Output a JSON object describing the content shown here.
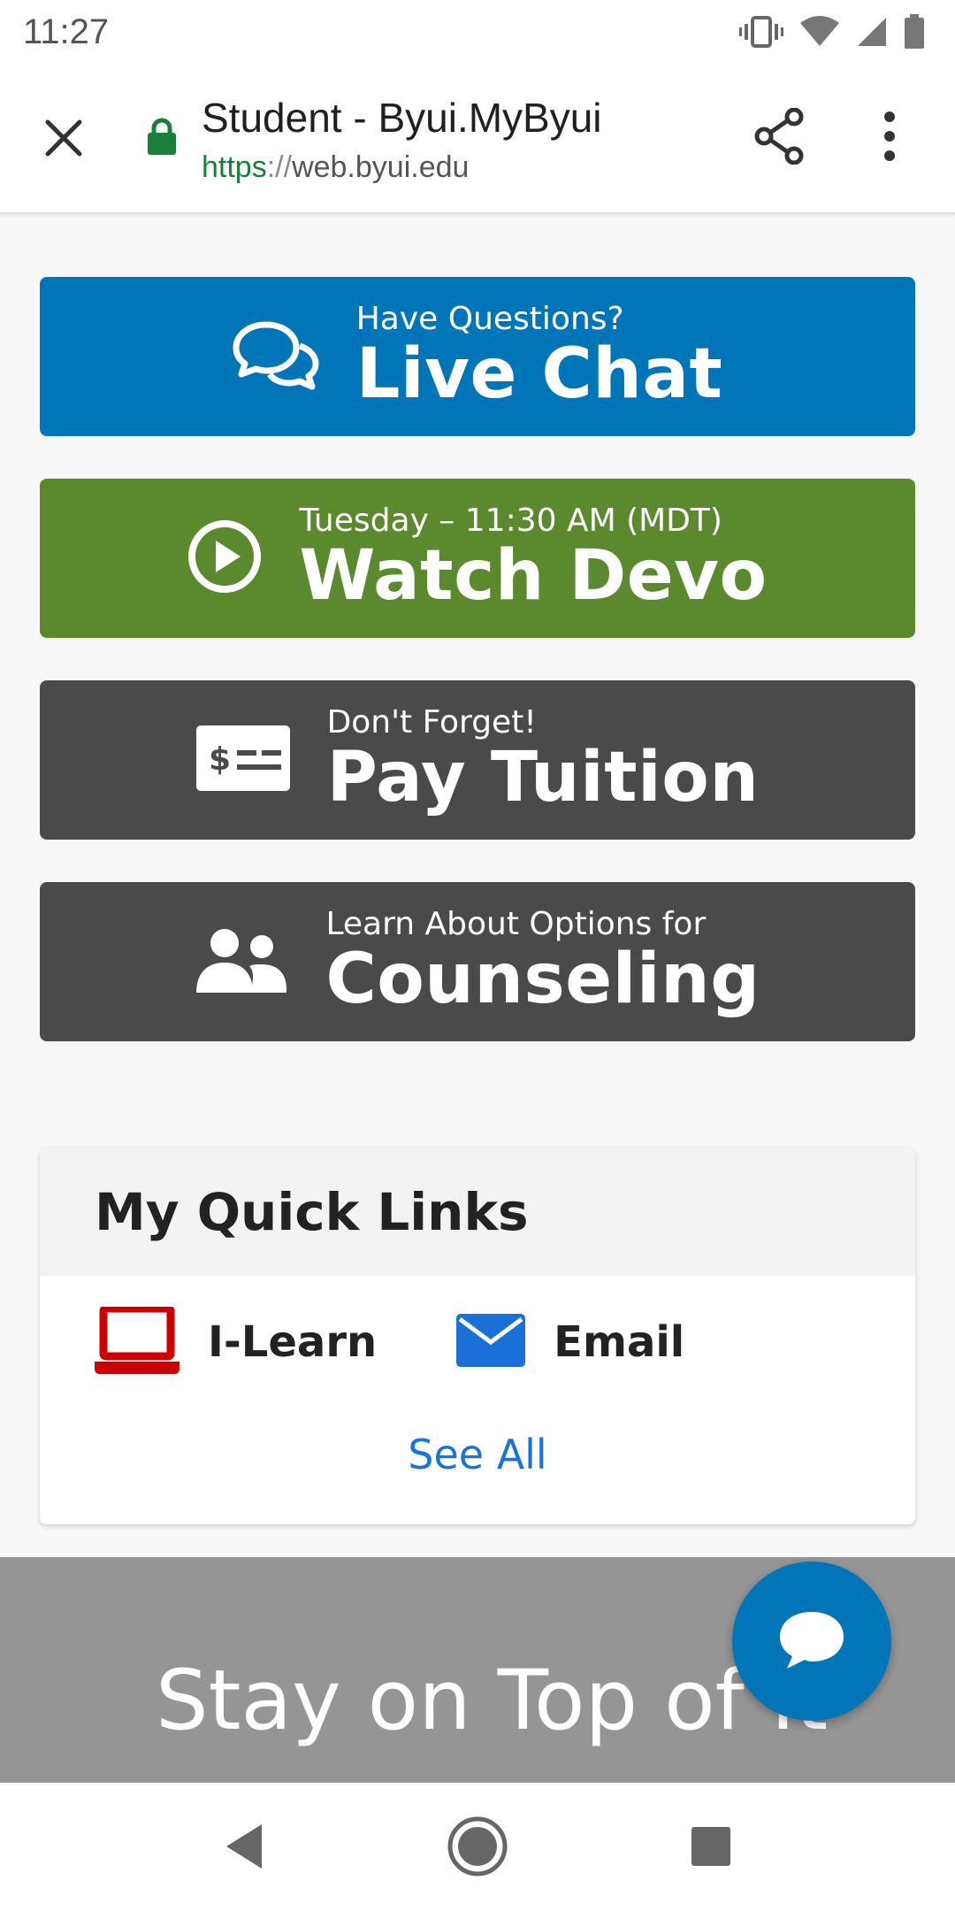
{
  "status_bar": {
    "time": "11:27",
    "icons": [
      "vibrate-icon",
      "wifi-icon",
      "signal-icon",
      "battery-icon"
    ]
  },
  "toolbar": {
    "title": "Student - Byui.MyByui",
    "url_scheme": "https",
    "url_separator": "://",
    "url_host": "web.byui.edu",
    "icons": [
      "close-icon",
      "lock-icon",
      "share-icon",
      "more-vert-icon"
    ]
  },
  "actions": [
    {
      "subtitle": "Have Questions?",
      "title": "Live Chat",
      "icon": "chat-bubbles-icon",
      "color": "#0076b8"
    },
    {
      "subtitle": "Tuesday – 11:30 AM (MDT)",
      "title": "Watch Devo",
      "icon": "play-circle-icon",
      "color": "#5b8a2e"
    },
    {
      "subtitle": "Don't Forget!",
      "title": "Pay Tuition",
      "icon": "money-check-icon",
      "color": "#4a4a4a"
    },
    {
      "subtitle": "Learn About Options for",
      "title": "Counseling",
      "icon": "users-icon",
      "color": "#4a4a4a"
    }
  ],
  "quick_links": {
    "title": "My Quick Links",
    "items": [
      {
        "label": "I-Learn",
        "icon": "laptop-icon",
        "color": "#cc0000"
      },
      {
        "label": "Email",
        "icon": "envelope-icon",
        "color": "#1a6fd9"
      }
    ],
    "see_all": "See All"
  },
  "banner": {
    "text": "Stay on Top of It"
  },
  "fab": {
    "icon": "chat-icon"
  },
  "nav_bar": {
    "icons": [
      "back-icon",
      "home-icon",
      "recents-icon"
    ]
  }
}
